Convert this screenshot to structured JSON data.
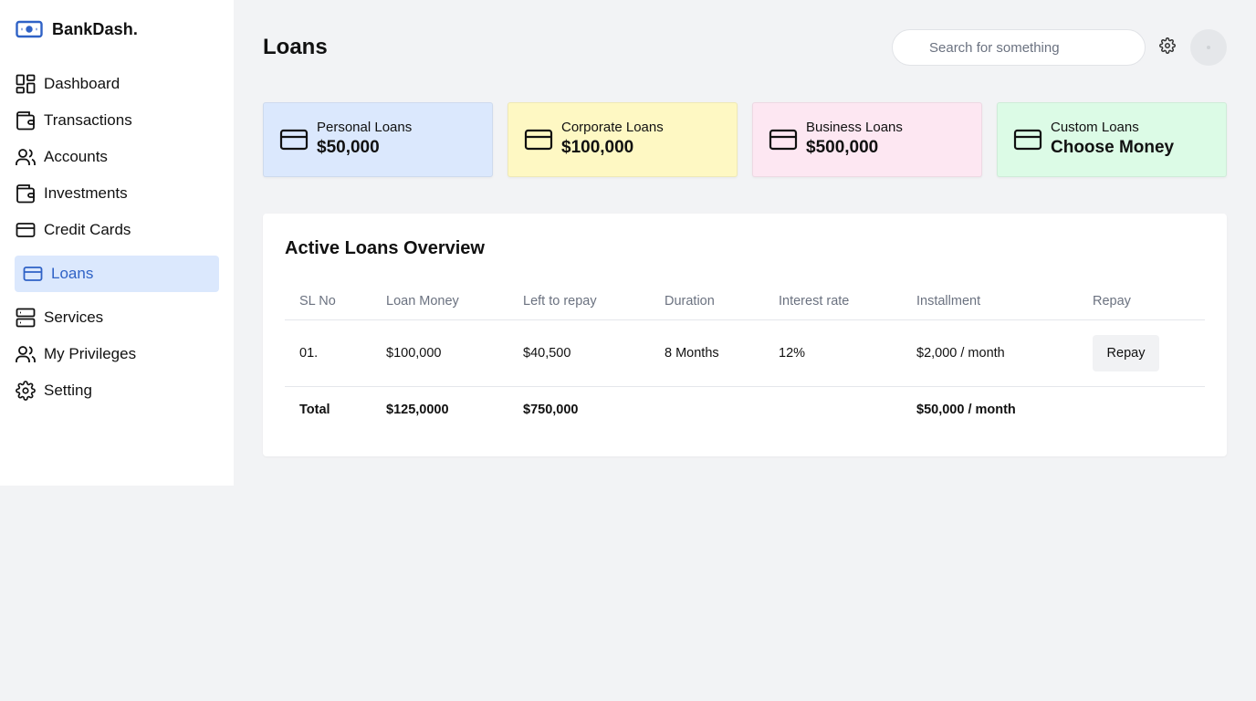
{
  "brand": {
    "name": "BankDash."
  },
  "sidebar": {
    "items": [
      {
        "label": "Dashboard",
        "icon": "dashboard-icon"
      },
      {
        "label": "Transactions",
        "icon": "wallet-icon"
      },
      {
        "label": "Accounts",
        "icon": "users-icon"
      },
      {
        "label": "Investments",
        "icon": "wallet-icon"
      },
      {
        "label": "Credit Cards",
        "icon": "credit-card-icon"
      },
      {
        "label": "Loans",
        "icon": "credit-card-icon",
        "active": true
      },
      {
        "label": "Services",
        "icon": "server-icon"
      },
      {
        "label": "My Privileges",
        "icon": "users-icon"
      },
      {
        "label": "Setting",
        "icon": "gear-icon"
      }
    ]
  },
  "header": {
    "title": "Loans",
    "search_placeholder": "Search for something"
  },
  "cards": [
    {
      "label": "Personal Loans",
      "value": "$50,000",
      "color": "#dbe8fd"
    },
    {
      "label": "Corporate Loans",
      "value": "$100,000",
      "color": "#fef8c3"
    },
    {
      "label": "Business Loans",
      "value": "$500,000",
      "color": "#fde7f2"
    },
    {
      "label": "Custom Loans",
      "value": "Choose Money",
      "color": "#dcfbe6"
    }
  ],
  "overview": {
    "title": "Active Loans Overview",
    "columns": [
      "SL No",
      "Loan Money",
      "Left to repay",
      "Duration",
      "Interest rate",
      "Installment",
      "Repay"
    ],
    "rows": [
      {
        "sl": "01.",
        "loan_money": "$100,000",
        "left": "$40,500",
        "duration": "8 Months",
        "rate": "12%",
        "installment": "$2,000 / month",
        "repay_label": "Repay"
      }
    ],
    "total": {
      "label": "Total",
      "loan_money": "$125,0000",
      "left": "$750,000",
      "installment": "$50,000 / month"
    }
  },
  "colors": {
    "accent": "#2f62c6",
    "active_bg": "#dbe8fd",
    "page_bg": "#f2f3f5"
  }
}
